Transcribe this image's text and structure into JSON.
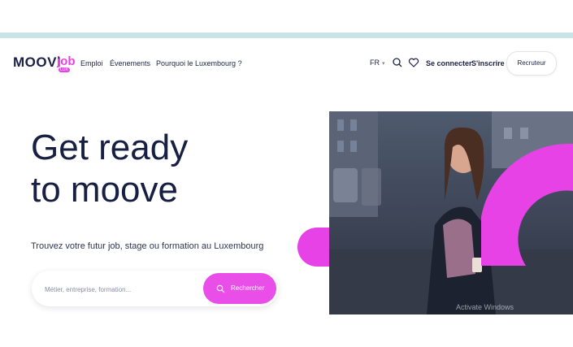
{
  "brand": {
    "logo_main": "MOOVI",
    "logo_accent": "job",
    "logo_sub": "LUX",
    "accent_color": "#e642e6"
  },
  "nav": {
    "items": [
      "Emploi",
      "Évenements",
      "Pourquoi le Luxembourg ?"
    ]
  },
  "header_right": {
    "lang": "FR",
    "search_icon": "search-icon",
    "favorites_icon": "heart-icon",
    "login": "Se connecter",
    "signup": "S'inscrire",
    "recruiter": "Recruteur"
  },
  "hero": {
    "title_line1": "Get ready",
    "title_line2": "to moove",
    "subtitle": "Trouvez votre futur job, stage ou formation au Luxembourg",
    "search_placeholder": "Métier, entreprise, formation...",
    "search_button": "Rechercher",
    "watermark": "Activate Windows"
  }
}
